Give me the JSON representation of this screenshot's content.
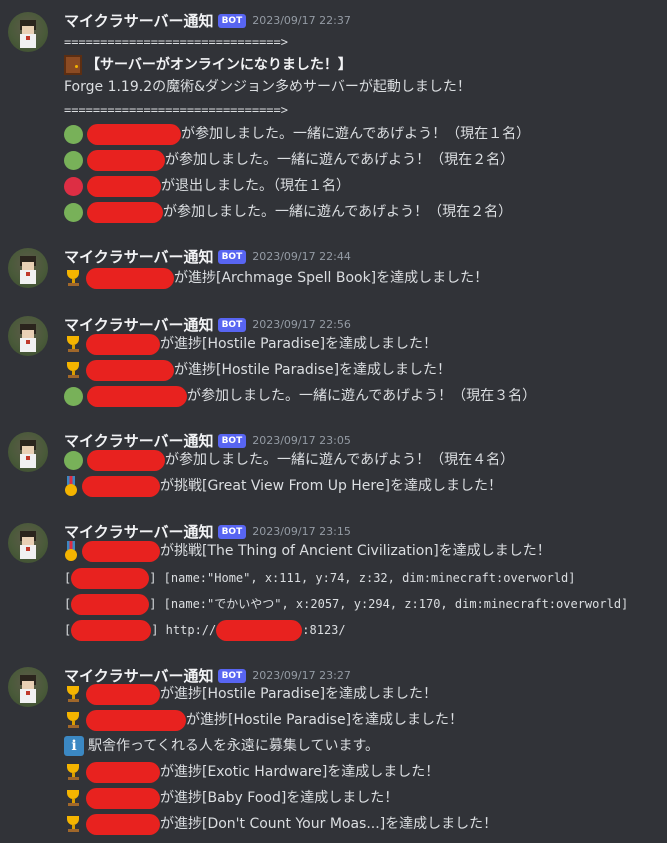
{
  "bot": {
    "username": "マイクラサーバー通知",
    "badge": "BOT"
  },
  "colors": {
    "background": "#313338",
    "redaction": "#e8221f",
    "online": "#78b159",
    "offline": "#dd2e44",
    "bot_badge": "#5865f2"
  },
  "groups": [
    {
      "timestamp": "2023/09/17 22:37",
      "lines": [
        {
          "text": "==============================>"
        },
        {
          "icon": "door-icon",
          "text": "【サーバーがオンラインになりました！】"
        },
        {
          "text": "Forge 1.19.2の魔術&ダンジョン多めサーバーが起動しました！"
        },
        {
          "text": "==============================>"
        },
        {
          "icon": "green-circle-icon",
          "text": "が参加しました。一緒に遊んであげよう！（現在１名）"
        },
        {
          "icon": "green-circle-icon",
          "text": "が参加しました。一緒に遊んであげよう！（現在２名）"
        },
        {
          "icon": "red-circle-icon",
          "text": "が退出しました。（現在１名）"
        },
        {
          "icon": "green-circle-icon",
          "text": "が参加しました。一緒に遊んであげよう！（現在２名）"
        }
      ]
    },
    {
      "timestamp": "2023/09/17 22:44",
      "lines": [
        {
          "icon": "trophy-icon",
          "text": "が進捗[Archmage Spell Book]を達成しました！"
        }
      ]
    },
    {
      "timestamp": "2023/09/17 22:56",
      "lines": [
        {
          "icon": "trophy-icon",
          "text": "が進捗[Hostile Paradise]を達成しました！"
        },
        {
          "icon": "trophy-icon",
          "text": "が進捗[Hostile Paradise]を達成しました！"
        },
        {
          "icon": "green-circle-icon",
          "text": "が参加しました。一緒に遊んであげよう！（現在３名）"
        }
      ]
    },
    {
      "timestamp": "2023/09/17 23:05",
      "lines": [
        {
          "icon": "green-circle-icon",
          "text": "が参加しました。一緒に遊んであげよう！（現在４名）"
        },
        {
          "icon": "medal-icon",
          "text": "が挑戦[Great View From Up Here]を達成しました！"
        }
      ]
    },
    {
      "timestamp": "2023/09/17 23:15",
      "lines": [
        {
          "icon": "medal-icon",
          "text": "が挑戦[The Thing of Ancient Civilization]を達成しました！"
        },
        {
          "prefix": "[",
          "text": "] [name:\"Home\", x:111, y:74, z:32, dim:minecraft:overworld]"
        },
        {
          "prefix": "[",
          "text": "] [name:\"でかいやつ\", x:2057, y:294, z:170, dim:minecraft:overworld]"
        },
        {
          "prefix": "[",
          "text": "] http://",
          "suffix": ":8123/"
        }
      ]
    },
    {
      "timestamp": "2023/09/17 23:27",
      "lines": [
        {
          "icon": "trophy-icon",
          "text": "が進捗[Hostile Paradise]を達成しました！"
        },
        {
          "icon": "trophy-icon",
          "text": "が進捗[Hostile Paradise]を達成しました！"
        },
        {
          "icon": "info-icon",
          "text": "駅舎作ってくれる人を永遠に募集しています。"
        },
        {
          "icon": "trophy-icon",
          "text": "が進捗[Exotic Hardware]を達成しました！"
        },
        {
          "icon": "trophy-icon",
          "text": "が進捗[Baby Food]を達成しました！"
        },
        {
          "icon": "trophy-icon",
          "text": "が進捗[Don't Count Your Moas...]を達成しました！"
        }
      ]
    }
  ]
}
